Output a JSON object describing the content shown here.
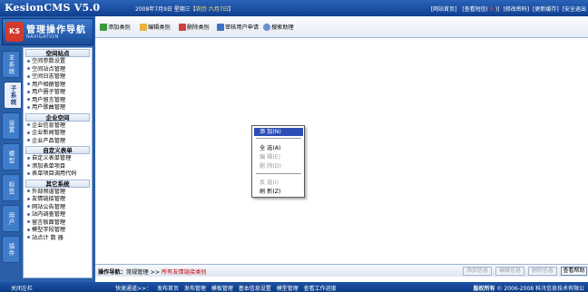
{
  "topbar": {
    "logo": "KesionCMS V5.0",
    "date_prefix": "2008年7月9日 星期三【",
    "lunar": "农历 六月7日",
    "date_suffix": "】",
    "links": [
      "[网站首页]",
      "[查看短信(",
      "0",
      ")]",
      "[修改密码]",
      "[更新缓存]",
      "[安全退出"
    ]
  },
  "nav": {
    "badge": "KS",
    "title": "管理操作导航",
    "subtitle": "NAVIGATION",
    "tabs": [
      "主系统",
      "子系统",
      "设置",
      "模型",
      "标签",
      "用户",
      "插件"
    ],
    "groups": [
      {
        "title": "空间站点",
        "items": [
          "空间参数设置",
          "空间站点管理",
          "空间日志管理",
          "用户相册管理",
          "用户圈子管理",
          "用户留言管理",
          "用户歌曲管理"
        ]
      },
      {
        "title": "企业空间",
        "items": [
          "企业信息管理",
          "企业新闻管理",
          "企业产品管理"
        ]
      },
      {
        "title": "自定义表单",
        "items": [
          "自定义表单管理",
          "添加表单项目",
          "表单项目调用代码"
        ]
      },
      {
        "title": "其它系统",
        "items": [
          "外部频道管理",
          "友情链接管理",
          "网站公告管理",
          "站内调查管理",
          "留言板面管理",
          "模型字段管理",
          "站点计 数 器"
        ]
      }
    ]
  },
  "toolbar": {
    "buttons": [
      "添加类别",
      "编辑类别",
      "删除类别",
      "审核用户申请",
      "搜索助理"
    ]
  },
  "context_menu": {
    "items": [
      "添 加(N)",
      "全 选(A)",
      "编 辑(E)",
      "删 除(D)",
      "反 选(I)",
      "刷 新(Z)"
    ]
  },
  "status": {
    "label": "操作导航：",
    "path": "常规管理",
    "arrow": " >> ",
    "current": "所有友情链接类别",
    "buttons": [
      "添加信息",
      "编辑信息",
      "删除信息",
      "查看帮助"
    ]
  },
  "bottombar": {
    "close": "关闭左栏",
    "quick_label": "快速通道>>：",
    "quick_links": [
      "发布首页",
      "发布管理",
      "模板管理",
      "基本信息设置",
      "模型管理",
      "查看工作进度"
    ],
    "copyright_bold": "版权所有",
    "copyright": "© 2006-2008 科汛信息技术有限公"
  }
}
